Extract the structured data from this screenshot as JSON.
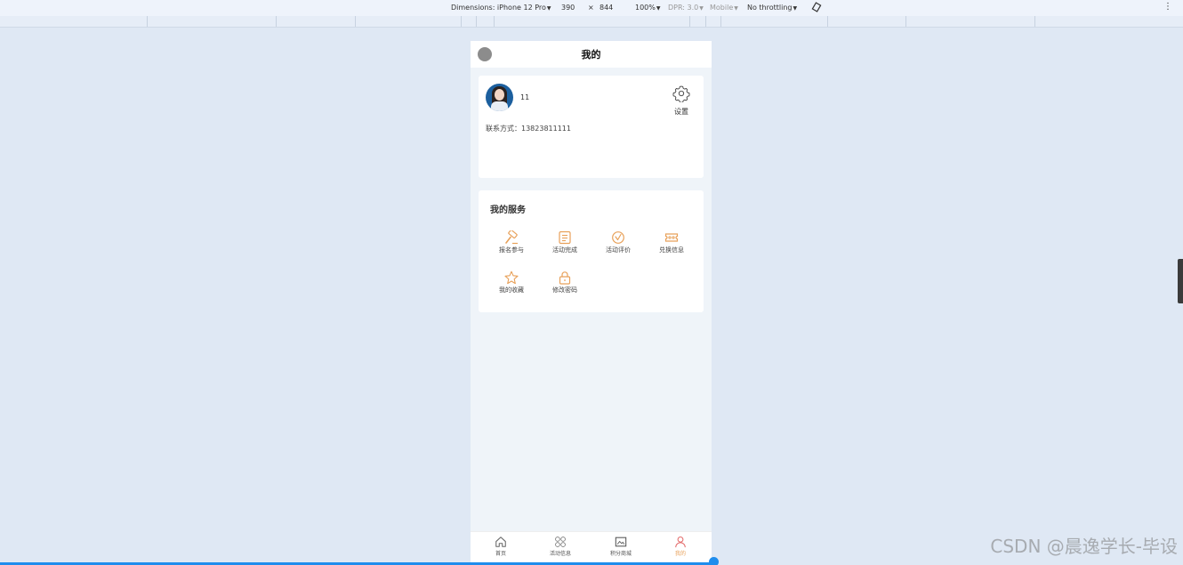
{
  "devtools": {
    "dimensions_label": "Dimensions: iPhone 12 Pro",
    "width": "390",
    "times": "×",
    "height": "844",
    "zoom": "100%",
    "dpr": "DPR: 3.0",
    "mobile": "Mobile",
    "throttling": "No throttling"
  },
  "navbar": {
    "title": "我的"
  },
  "profile": {
    "username": "11",
    "settings_label": "设置",
    "contact": "联系方式：13823811111"
  },
  "services": {
    "heading": "我的服务",
    "items": [
      {
        "label": "报名参与",
        "icon": "hammer-icon"
      },
      {
        "label": "活动完成",
        "icon": "calendar-list-icon"
      },
      {
        "label": "活动评价",
        "icon": "check-circle-icon"
      },
      {
        "label": "兑换信息",
        "icon": "ticket-icon"
      },
      {
        "label": "我的收藏",
        "icon": "star-icon"
      },
      {
        "label": "修改密码",
        "icon": "lock-icon"
      }
    ]
  },
  "tabbar": {
    "items": [
      {
        "label": "首页",
        "icon": "home-icon"
      },
      {
        "label": "活动信息",
        "icon": "grid-circles-icon"
      },
      {
        "label": "积分商城",
        "icon": "image-frame-icon"
      },
      {
        "label": "我的",
        "icon": "user-icon"
      }
    ],
    "active_index": 3
  },
  "watermark": "CSDN @晨逸学长-毕设",
  "colors": {
    "accent": "#e8a15a",
    "background": "#eff4f9",
    "page": "#dfe8f4"
  }
}
